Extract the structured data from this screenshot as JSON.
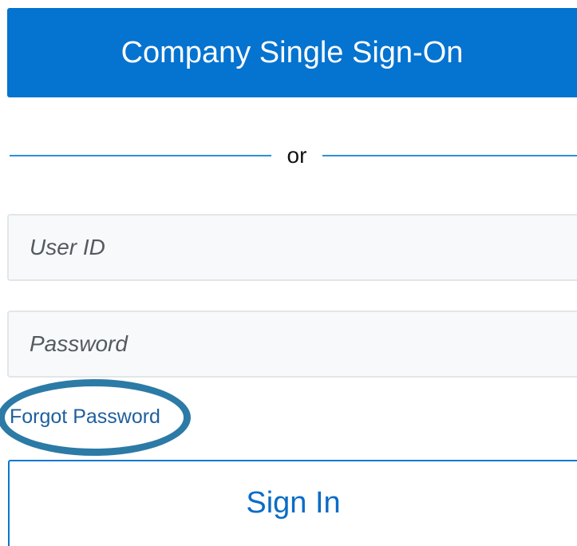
{
  "sso_button": {
    "label": "Company Single Sign-On"
  },
  "divider": {
    "text": "or"
  },
  "user_id_field": {
    "placeholder": "User ID",
    "value": ""
  },
  "password_field": {
    "placeholder": "Password",
    "value": ""
  },
  "forgot_password_link": {
    "label": "Forgot Password"
  },
  "sign_in_button": {
    "label": "Sign In"
  },
  "colors": {
    "primary": "#0573d0",
    "divider": "#2f8fd8",
    "link": "#1f5f9e",
    "annotation_ring": "#2c7aa6",
    "field_background": "#f7f9fb",
    "field_border": "#e3e6e9"
  }
}
